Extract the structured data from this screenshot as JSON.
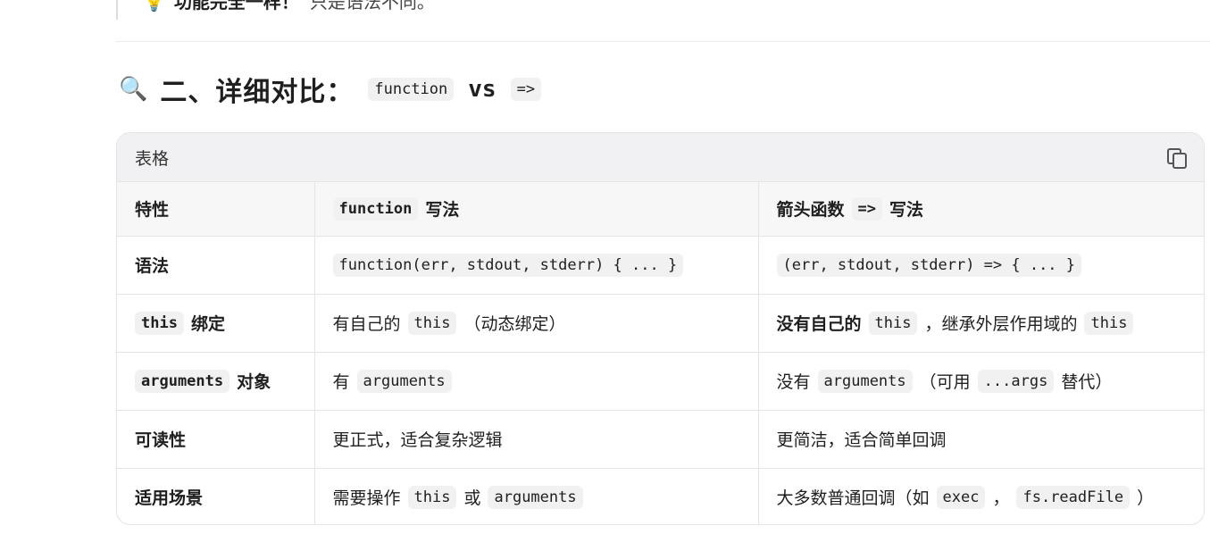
{
  "callout": {
    "bold": "功能完全一样！",
    "text": "只是语法不同。"
  },
  "heading": {
    "icon": "magnifier-icon",
    "text": "二、详细对比：",
    "code1": "function",
    "vs": "vs",
    "code2": "=>"
  },
  "table": {
    "title": "表格",
    "copy_icon": "copy-icon",
    "headers": {
      "col1": "特性",
      "col2_code": "function",
      "col2_text": "写法",
      "col3_text_a": "箭头函数",
      "col3_code": "=>",
      "col3_text_b": "写法"
    },
    "rows": {
      "syntax": {
        "label": "语法",
        "func": "function(err, stdout, stderr) { ... }",
        "arrow": "(err, stdout, stderr) => { ... }"
      },
      "this": {
        "label_code": "this",
        "label_text": "绑定",
        "func_a": "有自己的",
        "func_code": "this",
        "func_b": "（动态绑定）",
        "arrow_bold": "没有自己的",
        "arrow_code1": "this",
        "arrow_b": "，继承外层作用域的",
        "arrow_code2": "this"
      },
      "arguments": {
        "label_code": "arguments",
        "label_text": "对象",
        "func_a": "有",
        "func_code": "arguments",
        "arrow_a": "没有",
        "arrow_code1": "arguments",
        "arrow_b": "（可用",
        "arrow_code2": "...args",
        "arrow_c": "替代）"
      },
      "readability": {
        "label": "可读性",
        "func": "更正式，适合复杂逻辑",
        "arrow": "更简洁，适合简单回调"
      },
      "usage": {
        "label": "适用场景",
        "func_a": "需要操作",
        "func_code1": "this",
        "func_b": "或",
        "func_code2": "arguments",
        "arrow_a": "大多数普通回调（如",
        "arrow_code1": "exec",
        "arrow_b": "，",
        "arrow_code2": "fs.readFile",
        "arrow_c": "）"
      }
    }
  }
}
